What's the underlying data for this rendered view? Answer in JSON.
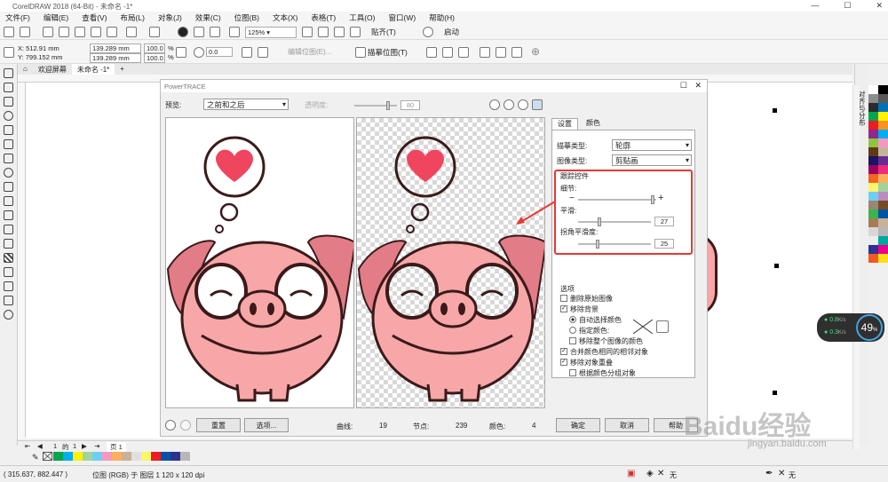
{
  "app": {
    "title": "CorelDRAW 2018 (64-Bit) - 未命名 -1*"
  },
  "menu": [
    "文件(F)",
    "编辑(E)",
    "查看(V)",
    "布局(L)",
    "对象(J)",
    "效果(C)",
    "位图(B)",
    "文本(X)",
    "表格(T)",
    "工具(O)",
    "窗口(W)",
    "帮助(H)"
  ],
  "toolbar": {
    "zoom": "125%",
    "snap": "贴齐(T)",
    "launch": "启动"
  },
  "props": {
    "x": "X: 512.91 mm",
    "y": "Y: 799.152 mm",
    "w": "139.289 mm",
    "h": "139.289 mm",
    "sx": "100.0",
    "sy": "100.0",
    "pct": "%",
    "rot": "0.0",
    "edit_bitmap": "编辑位图(E)...",
    "trace_bitmap": "描摹位图(T)"
  },
  "tabs": [
    "欢迎屏幕",
    "未命名 -1*"
  ],
  "dialog": {
    "title": "PowerTRACE",
    "preview_label": "预览:",
    "preview_value": "之前和之后",
    "transparency_label": "透明度:",
    "transparency_value": "80",
    "tab_settings": "设置",
    "tab_colors": "颜色",
    "trace_type_label": "描摹类型:",
    "trace_type": "轮廓",
    "image_type_label": "图像类型:",
    "image_type": "剪贴画",
    "controls_title": "跟踪控件",
    "detail_label": "细节:",
    "smooth_label": "平滑:",
    "smooth_value": "27",
    "corner_label": "拐角平滑度:",
    "corner_value": "25",
    "options_title": "选项",
    "opt_delete_original": "删除原始图像",
    "opt_remove_bg": "移除背景",
    "opt_auto_color": "自动选择颜色",
    "opt_specify_color": "指定颜色:",
    "opt_remove_all": "移除整个图像的颜色",
    "opt_merge_adjacent": "合并颜色相同的相邻对象",
    "opt_remove_overlap": "移除对象重叠",
    "opt_group_by_color": "根据颜色分组对象",
    "reset": "重置",
    "options_btn": "选项...",
    "curves_label": "曲线:",
    "curves": "19",
    "nodes_label": "节点:",
    "nodes": "239",
    "colors_label": "颜色:",
    "colors": "4",
    "ok": "确定",
    "cancel": "取消",
    "help": "帮助"
  },
  "docker": {
    "label": "对齐与分布"
  },
  "network": {
    "up": "0.8",
    "up_unit": "K/s",
    "down": "0.3",
    "down_unit": "K/s",
    "percent": "49",
    "percent_unit": "%"
  },
  "page_nav": {
    "current": "1",
    "of": "的",
    "total": "1",
    "page_label": "页 1"
  },
  "status": {
    "coords": "( 315.637, 882.447 )",
    "info": "位图 (RGB) 于 图层 1 120 x 120 dpi",
    "fill": "无",
    "outline": "无"
  },
  "watermark": {
    "text": "Baidu经验",
    "url": "jingyan.baidu.com"
  },
  "colors": {
    "heart": "#f0455f",
    "pig": "#f7a7a7",
    "pig_dark": "#e27d87",
    "outline": "#3a1a1a",
    "highlight": "#e53935"
  }
}
